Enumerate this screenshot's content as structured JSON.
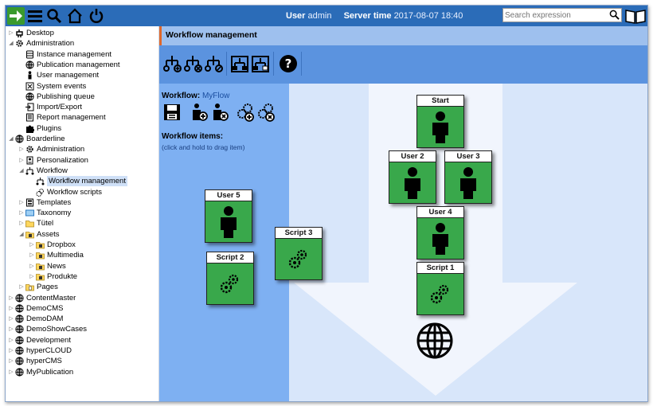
{
  "topbar": {
    "user_label": "User",
    "user_value": "admin",
    "time_label": "Server time",
    "time_value": "2017-08-07 18:40",
    "search_placeholder": "Search expression"
  },
  "tree": [
    {
      "label": "Desktop",
      "icon": "desktop-icon",
      "level": 0,
      "exp": "▷"
    },
    {
      "label": "Administration",
      "icon": "gear-icon",
      "level": 0,
      "exp": "◢"
    },
    {
      "label": "Instance management",
      "icon": "database-icon",
      "level": 1,
      "exp": ""
    },
    {
      "label": "Publication management",
      "icon": "globe-icon",
      "level": 1,
      "exp": ""
    },
    {
      "label": "User management",
      "icon": "user-icon",
      "level": 1,
      "exp": ""
    },
    {
      "label": "System events",
      "icon": "events-icon",
      "level": 1,
      "exp": ""
    },
    {
      "label": "Publishing queue",
      "icon": "globe-icon",
      "level": 1,
      "exp": ""
    },
    {
      "label": "Import/Export",
      "icon": "import-export-icon",
      "level": 1,
      "exp": ""
    },
    {
      "label": "Report management",
      "icon": "report-icon",
      "level": 1,
      "exp": ""
    },
    {
      "label": "Plugins",
      "icon": "puzzle-icon",
      "level": 1,
      "exp": ""
    },
    {
      "label": "Boarderline",
      "icon": "globe-icon",
      "level": 0,
      "exp": "◢"
    },
    {
      "label": "Administration",
      "icon": "gear-icon",
      "level": 1,
      "exp": "▷"
    },
    {
      "label": "Personalization",
      "icon": "personalization-icon",
      "level": 1,
      "exp": "▷"
    },
    {
      "label": "Workflow",
      "icon": "workflow-icon",
      "level": 1,
      "exp": "◢"
    },
    {
      "label": "Workflow management",
      "icon": "workflow-icon",
      "level": 2,
      "exp": "",
      "selected": true
    },
    {
      "label": "Workflow scripts",
      "icon": "script-icon",
      "level": 2,
      "exp": ""
    },
    {
      "label": "Templates",
      "icon": "template-icon",
      "level": 1,
      "exp": "▷"
    },
    {
      "label": "Taxonomy",
      "icon": "taxonomy-icon",
      "level": 1,
      "exp": "▷"
    },
    {
      "label": "Tütel",
      "icon": "folder-icon",
      "level": 1,
      "exp": "▷"
    },
    {
      "label": "Assets",
      "icon": "assets-folder-icon",
      "level": 1,
      "exp": "◢"
    },
    {
      "label": "Dropbox",
      "icon": "assets-folder-icon",
      "level": 2,
      "exp": "▷"
    },
    {
      "label": "Multimedia",
      "icon": "assets-folder-icon",
      "level": 2,
      "exp": "▷"
    },
    {
      "label": "News",
      "icon": "assets-folder-icon",
      "level": 2,
      "exp": "▷"
    },
    {
      "label": "Produkte",
      "icon": "assets-folder-icon",
      "level": 2,
      "exp": "▷"
    },
    {
      "label": "Pages",
      "icon": "pages-folder-icon",
      "level": 1,
      "exp": "▷"
    },
    {
      "label": "ContentMaster",
      "icon": "globe-icon",
      "level": 0,
      "exp": "▷"
    },
    {
      "label": "DemoCMS",
      "icon": "globe-icon",
      "level": 0,
      "exp": "▷"
    },
    {
      "label": "DemoDAM",
      "icon": "globe-icon",
      "level": 0,
      "exp": "▷"
    },
    {
      "label": "DemoShowCases",
      "icon": "globe-icon",
      "level": 0,
      "exp": "▷"
    },
    {
      "label": "Development",
      "icon": "globe-icon",
      "level": 0,
      "exp": "▷"
    },
    {
      "label": "hyperCLOUD",
      "icon": "globe-icon",
      "level": 0,
      "exp": "▷"
    },
    {
      "label": "hyperCMS",
      "icon": "globe-icon",
      "level": 0,
      "exp": "▷"
    },
    {
      "label": "MyPublication",
      "icon": "globe-icon",
      "level": 0,
      "exp": "▷"
    }
  ],
  "main": {
    "title": "Workflow management",
    "workflow_label": "Workflow:",
    "workflow_name": "MyFlow",
    "items_label": "Workflow items:",
    "items_hint": "(click and hold to drag item)"
  },
  "cards": {
    "start": "Start",
    "user2": "User 2",
    "user3": "User 3",
    "user4": "User 4",
    "script1": "Script 1",
    "user5": "User 5",
    "script2": "Script 2",
    "script3": "Script 3"
  },
  "colors": {
    "topbar": "#2b6cb8",
    "toolbar": "#5b93df",
    "card_green": "#39a84b",
    "accent": "#e0682b"
  }
}
